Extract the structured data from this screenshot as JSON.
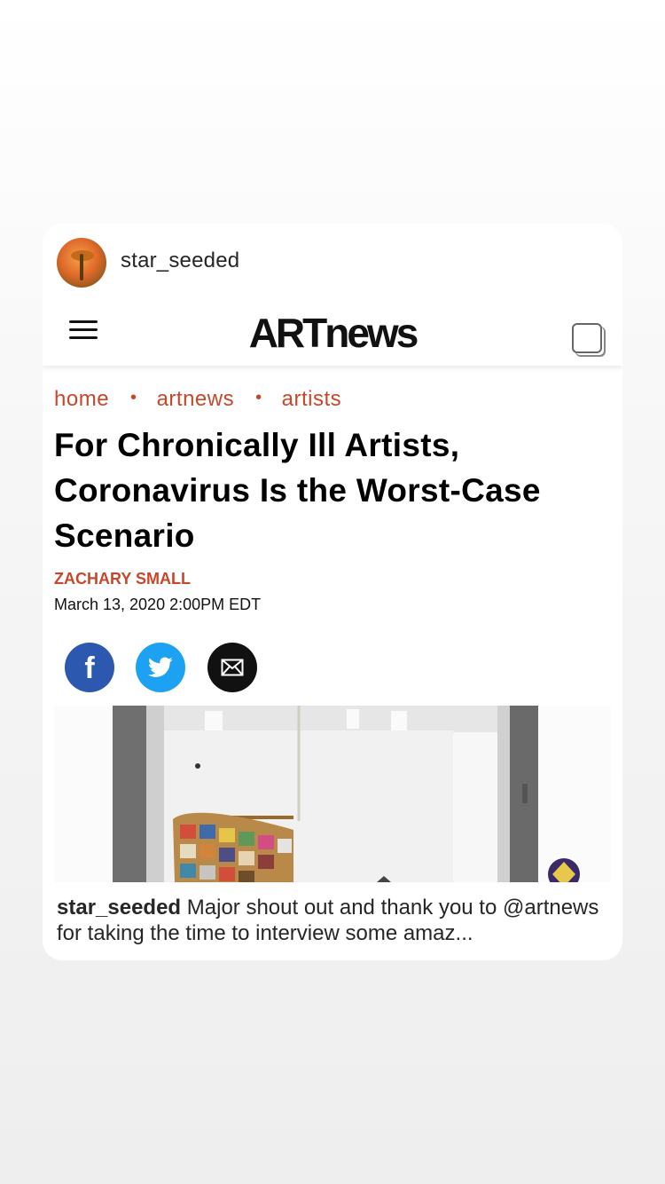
{
  "post": {
    "username": "star_seeded",
    "caption_username": "star_seeded",
    "caption_text": "Major shout out and thank you to @artnews for taking the time to interview some amaz..."
  },
  "site": {
    "logo": "ARTnews",
    "breadcrumb": [
      "home",
      "artnews",
      "artists"
    ],
    "headline": "For Chronically Ill Artists, Coronavirus Is the Worst-Case Scenario",
    "author": "ZACHARY SMALL",
    "date": "March 13, 2020 2:00PM EDT"
  },
  "icons": {
    "menu": "hamburger-menu-icon",
    "share": "share-icon",
    "facebook": "facebook-icon",
    "twitter": "twitter-icon",
    "email": "email-icon"
  },
  "colors": {
    "accent": "#c8472a",
    "facebook": "#2d58b0",
    "twitter": "#1da1f2",
    "email": "#111111"
  }
}
